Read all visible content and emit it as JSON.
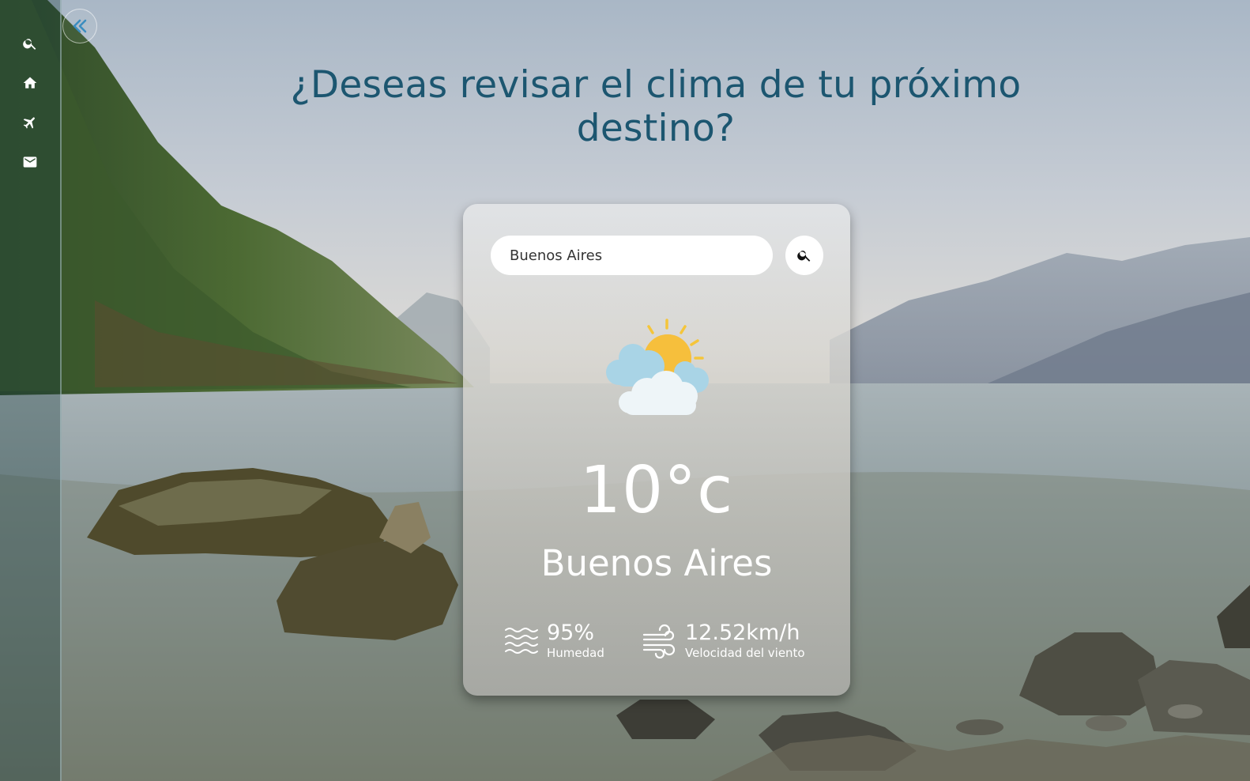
{
  "heading": "¿Deseas revisar el clima de tu próximo destino?",
  "sidebar": {
    "items": [
      {
        "icon": "search-icon"
      },
      {
        "icon": "home-icon"
      },
      {
        "icon": "airplane-icon"
      },
      {
        "icon": "mail-icon"
      }
    ],
    "collapse_icon": "double-chevron-left-icon"
  },
  "search": {
    "value": "Buenos Aires",
    "button_icon": "search-icon"
  },
  "weather": {
    "condition_icon": "partly-cloudy-icon",
    "temperature": "10°c",
    "city": "Buenos Aires",
    "humidity_value": "95%",
    "humidity_label": "Humedad",
    "wind_value": "12.52km/h",
    "wind_label": "Velocidad del viento"
  },
  "colors": {
    "heading": "#1c5670",
    "card_text": "#ffffff",
    "sun": "#f5b82e",
    "cloud": "#bfe0ee"
  }
}
